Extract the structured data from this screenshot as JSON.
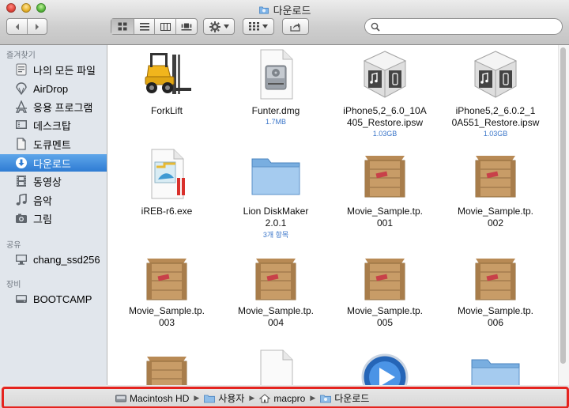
{
  "window": {
    "title": "다운로드"
  },
  "toolbar": {
    "back_icon": "chevron-left-icon",
    "forward_icon": "chevron-right-icon",
    "view_modes": [
      "icon-view",
      "list-view",
      "column-view",
      "cover-flow-view"
    ],
    "active_view": "icon-view",
    "action_icon": "gear-icon",
    "arrange_icon": "arrange-grid-icon",
    "share_icon": "share-icon",
    "search": {
      "placeholder": "",
      "value": ""
    }
  },
  "sidebar": {
    "favorites_header": "즐겨찾기",
    "favorites": [
      {
        "label": "나의 모든 파일",
        "icon": "all-my-files-icon"
      },
      {
        "label": "AirDrop",
        "icon": "airdrop-icon"
      },
      {
        "label": "응용 프로그램",
        "icon": "applications-icon"
      },
      {
        "label": "데스크탑",
        "icon": "desktop-icon"
      },
      {
        "label": "도큐멘트",
        "icon": "documents-icon"
      },
      {
        "label": "다운로드",
        "icon": "downloads-icon",
        "selected": true
      },
      {
        "label": "동영상",
        "icon": "movies-icon"
      },
      {
        "label": "음악",
        "icon": "music-icon"
      },
      {
        "label": "그림",
        "icon": "pictures-icon"
      }
    ],
    "shared_header": "공유",
    "shared": [
      {
        "label": "chang_ssd256",
        "icon": "computer-icon"
      }
    ],
    "devices_header": "장비",
    "devices": [
      {
        "label": "BOOTCAMP",
        "icon": "hard-drive-icon"
      }
    ]
  },
  "files": [
    {
      "name": "ForkLift",
      "meta": "",
      "icon": "forklift-app-icon"
    },
    {
      "name": "Funter.dmg",
      "meta": "1.7MB",
      "icon": "dmg-disk-icon"
    },
    {
      "name": "iPhone5,2_6.0_10A\n405_Restore.ipsw",
      "meta": "1.03GB",
      "icon": "ipsw-icon"
    },
    {
      "name": "iPhone5,2_6.0.2_1\n0A551_Restore.ipsw",
      "meta": "1.03GB",
      "icon": "ipsw-icon"
    },
    {
      "name": "iREB-r6.exe",
      "meta": "",
      "icon": "exe-file-icon"
    },
    {
      "name": "Lion DiskMaker\n2.0.1",
      "meta": "3개 항목",
      "icon": "folder-icon"
    },
    {
      "name": "Movie_Sample.tp.\n001",
      "meta": "",
      "icon": "archive-crate-icon"
    },
    {
      "name": "Movie_Sample.tp.\n002",
      "meta": "",
      "icon": "archive-crate-icon"
    },
    {
      "name": "Movie_Sample.tp.\n003",
      "meta": "",
      "icon": "archive-crate-icon"
    },
    {
      "name": "Movie_Sample.tp.\n004",
      "meta": "",
      "icon": "archive-crate-icon"
    },
    {
      "name": "Movie_Sample.tp.\n005",
      "meta": "",
      "icon": "archive-crate-icon"
    },
    {
      "name": "Movie_Sample.tp.\n006",
      "meta": "",
      "icon": "archive-crate-icon"
    },
    {
      "name": "",
      "meta": "",
      "icon": "archive-crate-icon"
    },
    {
      "name": "",
      "meta": "",
      "icon": "blank-document-icon"
    },
    {
      "name": "",
      "meta": "",
      "icon": "quicktime-icon"
    },
    {
      "name": "",
      "meta": "",
      "icon": "folder-icon"
    }
  ],
  "pathbar": {
    "crumbs": [
      {
        "label": "Macintosh HD",
        "icon": "hard-drive-icon"
      },
      {
        "label": "사용자",
        "icon": "folder-icon"
      },
      {
        "label": "macpro",
        "icon": "home-icon"
      },
      {
        "label": "다운로드",
        "icon": "downloads-folder-icon"
      }
    ],
    "highlight_color": "#e5231e"
  },
  "colors": {
    "selection": "#2f7cd3",
    "sidebar_bg": "#e1e6ec",
    "meta_text": "#3b76c9"
  }
}
